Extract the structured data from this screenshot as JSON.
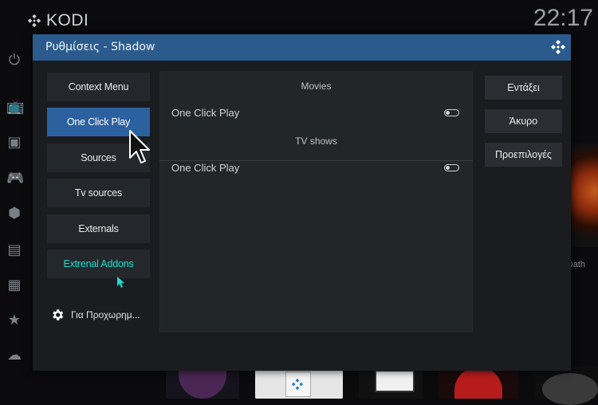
{
  "background": {
    "app_name": "KODI",
    "clock": "22:17",
    "right_label": "Dath"
  },
  "dialog": {
    "title": "Ρυθμίσεις - Shadow",
    "categories": [
      {
        "label": "Context Menu"
      },
      {
        "label": "One Click Play"
      },
      {
        "label": "Sources"
      },
      {
        "label": "Tv sources"
      },
      {
        "label": "Externals"
      },
      {
        "label": "Extrenal Addons"
      }
    ],
    "advanced_label": "Για Προχωρημ...",
    "sections": [
      {
        "title": "Movies",
        "setting_label": "One Click Play"
      },
      {
        "title": "TV shows",
        "setting_label": "One Click Play"
      }
    ],
    "buttons": {
      "ok": "Εντάξει",
      "cancel": "Άκυρο",
      "defaults": "Προεπιλογές"
    }
  },
  "colors": {
    "titlebar": "#2b5b8c",
    "active_item": "#2c61a0",
    "highlight_text": "#18e0d2"
  }
}
